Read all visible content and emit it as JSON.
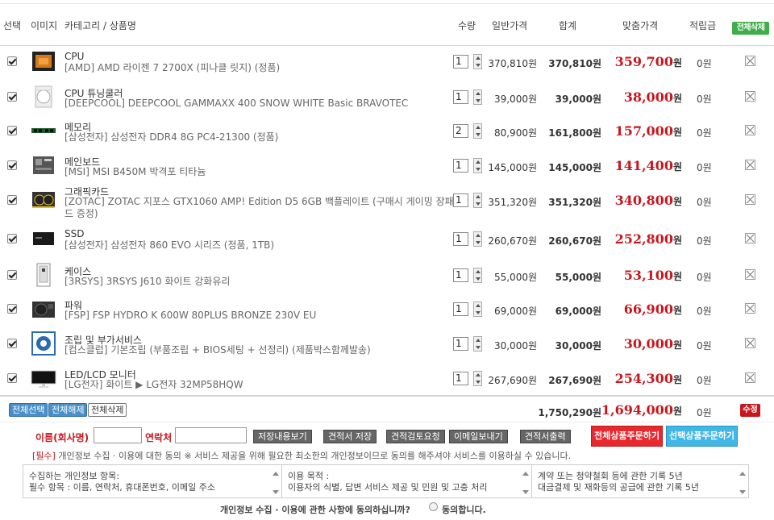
{
  "header": {
    "select": "선택",
    "image": "이미지",
    "category": "카테고리 / 상품명",
    "qty": "수량",
    "price": "일반가격",
    "sum": "합계",
    "sale": "맞춤가격",
    "points": "적립금",
    "delete_all": "전체삭제"
  },
  "items": [
    {
      "cat": "CPU",
      "name": "[AMD] AMD 라이젠 7 2700X (피나클 릿지) (정품)",
      "qty": "1",
      "price": "370,810원",
      "sum": "370,810원",
      "sale": "359,700",
      "unit": "원",
      "points": "0원",
      "icon": "cpu-icon"
    },
    {
      "cat": "CPU 튜닝쿨러",
      "name": "[DEEPCOOL] DEEPCOOL GAMMAXX 400 SNOW WHITE Basic BRAVOTEC",
      "qty": "1",
      "price": "39,000원",
      "sum": "39,000원",
      "sale": "38,000",
      "unit": "원",
      "points": "0원",
      "icon": "cooler-icon"
    },
    {
      "cat": "메모리",
      "name": "[삼성전자] 삼성전자 DDR4 8G PC4-21300 (정품)",
      "qty": "2",
      "price": "80,900원",
      "sum": "161,800원",
      "sale": "157,000",
      "unit": "원",
      "points": "0원",
      "icon": "memory-icon"
    },
    {
      "cat": "메인보드",
      "name": "[MSI] MSI B450M 박격포 티타늄",
      "qty": "1",
      "price": "145,000원",
      "sum": "145,000원",
      "sale": "141,400",
      "unit": "원",
      "points": "0원",
      "icon": "mainboard-icon"
    },
    {
      "cat": "그래픽카드",
      "name": "[ZOTAC] ZOTAC 지포스 GTX1060 AMP! Edition D5 6GB 백플레이트 (구매시 게이밍 장패",
      "name2": "드 증정)",
      "qty": "1",
      "price": "351,320원",
      "sum": "351,320원",
      "sale": "340,800",
      "unit": "원",
      "points": "0원",
      "icon": "gpu-icon"
    },
    {
      "cat": "SSD",
      "name": "[삼성전자] 삼성전자 860 EVO 시리즈 (정품, 1TB)",
      "qty": "1",
      "price": "260,670원",
      "sum": "260,670원",
      "sale": "252,800",
      "unit": "원",
      "points": "0원",
      "icon": "ssd-icon"
    },
    {
      "cat": "케이스",
      "name": "[3RSYS] 3RSYS J610 화이트 강화유리",
      "qty": "1",
      "price": "55,000원",
      "sum": "55,000원",
      "sale": "53,100",
      "unit": "원",
      "points": "0원",
      "icon": "case-icon"
    },
    {
      "cat": "파워",
      "name": "[FSP] FSP HYDRO K 600W 80PLUS BRONZE 230V EU",
      "qty": "1",
      "price": "69,000원",
      "sum": "69,000원",
      "sale": "66,900",
      "unit": "원",
      "points": "0원",
      "icon": "psu-icon"
    },
    {
      "cat": "조립 및 부가서비스",
      "name": "[컴스클럽] 기본조립 (부품조립 + BIOS세팅 + 선정리) (제품박스함께발송)",
      "qty": "1",
      "price": "30,000원",
      "sum": "30,000원",
      "sale": "30,000",
      "unit": "원",
      "points": "0원",
      "icon": "service-icon"
    },
    {
      "cat": "LED/LCD 모니터",
      "name": "[LG전자] 화이트 ▶ LG전자 32MP58HQW",
      "qty": "1",
      "price": "267,690원",
      "sum": "267,690원",
      "sale": "254,300",
      "unit": "원",
      "points": "0원",
      "icon": "monitor-icon"
    }
  ],
  "totals": {
    "select_all": "전체선택",
    "deselect_all": "전체해제",
    "delete_all": "전체삭제",
    "price": "1,750,290원",
    "sale": "1,694,000",
    "unit": "원",
    "points": "0원",
    "edit": "수정"
  },
  "form": {
    "name_label": "이름(회사명)",
    "contact_label": "연락처",
    "btn_view": "저장내용보기",
    "btn_save": "견적서 저장",
    "btn_review": "견적검토요청",
    "btn_email": "이메일보내기",
    "btn_print": "견적서출력",
    "btn_order_all": "전체상품주문하기",
    "btn_order_sel": "선택상품주문하기"
  },
  "consent": {
    "required": "[필수]",
    "text": " 개인정보 수집 · 이용에 대한 동의  ※ 서비스 제공을 위해 필요한 최소한의 개인정보이므로 동의를 해주셔야 서비스를 이용하실 수 있습니다.",
    "box1_l1": "수집하는 개인정보 항목:",
    "box1_l2": "필수 항목 : 이름, 연락처, 휴대폰번호, 이메일 주소",
    "box2_l1": "이용 목적 :",
    "box2_l2": "이용자의 식별, 답변 서비스 제공 및 민원 및 고충 처리",
    "box3_l1": "계약 또는 청약철회 등에 관한 기록 5년",
    "box3_l2": "대금결제 및 재화등의 공급에 관한 기록 5년",
    "question": "개인정보 수집 · 이용에 관한 사항에 동의하십니까?",
    "agree": "동의합니다."
  },
  "colors": {
    "accent_red": "#c8161d",
    "order_red": "#e8282e",
    "order_cyan": "#41b7e8",
    "select_blue": "#4a90c8",
    "delete_green": "#3fae49"
  }
}
